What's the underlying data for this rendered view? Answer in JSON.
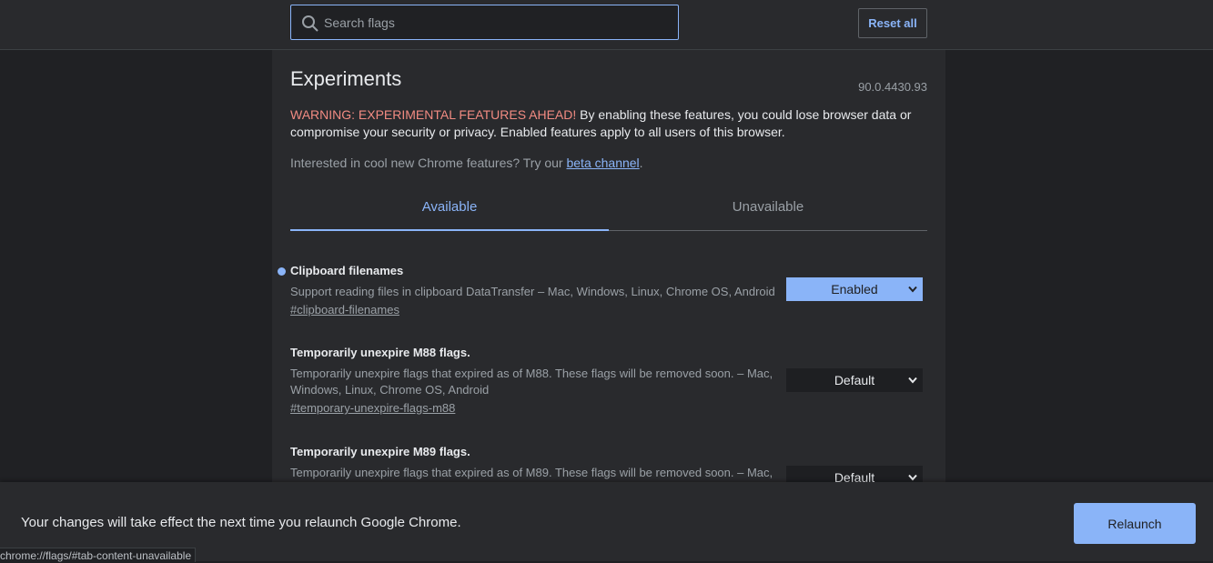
{
  "search": {
    "placeholder": "Search flags",
    "value": ""
  },
  "toolbar": {
    "reset_label": "Reset all"
  },
  "page": {
    "title": "Experiments",
    "version": "90.0.4430.93",
    "warning_prefix": "WARNING: EXPERIMENTAL FEATURES AHEAD!",
    "warning_text": " By enabling these features, you could lose browser data or compromise your security or privacy. Enabled features apply to all users of this browser.",
    "promo_text": "Interested in cool new Chrome features? Try our ",
    "promo_link": "beta channel",
    "promo_suffix": "."
  },
  "tabs": [
    {
      "label": "Available",
      "active": true
    },
    {
      "label": "Unavailable",
      "active": false
    }
  ],
  "flags": [
    {
      "title": "Clipboard filenames",
      "description": "Support reading files in clipboard DataTransfer – Mac, Windows, Linux, Chrome OS, Android",
      "link": "#clipboard-filenames",
      "selected": "Enabled",
      "modified": true
    },
    {
      "title": "Temporarily unexpire M88 flags.",
      "description": "Temporarily unexpire flags that expired as of M88. These flags will be removed soon. – Mac, Windows, Linux, Chrome OS, Android",
      "link": "#temporary-unexpire-flags-m88",
      "selected": "Default",
      "modified": false
    },
    {
      "title": "Temporarily unexpire M89 flags.",
      "description": "Temporarily unexpire flags that expired as of M89. These flags will be removed soon. – Mac,",
      "selected": "Default",
      "modified": false
    }
  ],
  "relaunch": {
    "message": "Your changes will take effect the next time you relaunch Google Chrome.",
    "button_label": "Relaunch"
  },
  "status_bar": {
    "url": "chrome://flags/#tab-content-unavailable"
  },
  "colors": {
    "accent": "#8ab4f8",
    "warning": "#f28b82",
    "background": "#202124",
    "panel": "#292a2d"
  }
}
